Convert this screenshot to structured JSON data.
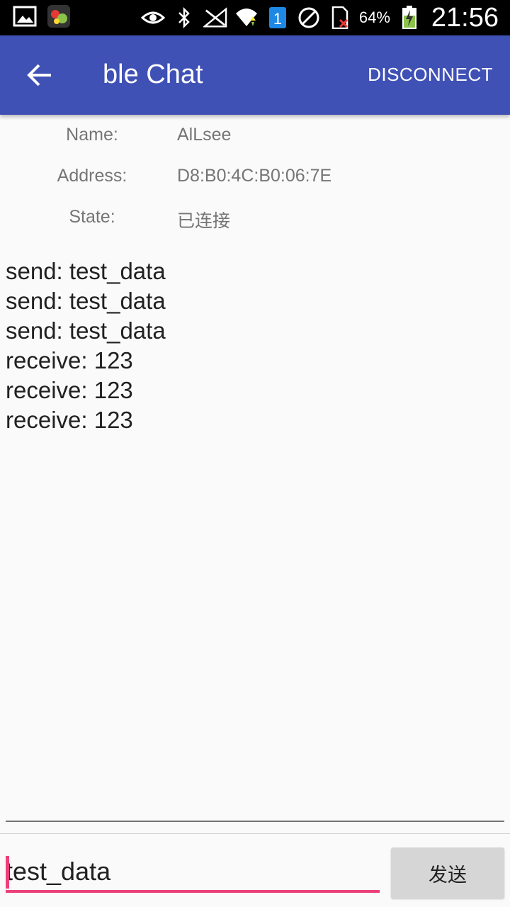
{
  "status_bar": {
    "battery_percent": "64%",
    "time": "21:56",
    "sim_badge": "1",
    "icons": [
      "gallery-icon",
      "app-notification-icon",
      "eye-icon",
      "bluetooth-icon",
      "no-signal-icon",
      "wifi-icon",
      "sim-icon",
      "block-icon",
      "sim-missing-icon",
      "battery-charging-icon"
    ]
  },
  "app_bar": {
    "title": "ble Chat",
    "action": "DISCONNECT",
    "color": "#3f51b5"
  },
  "device": {
    "name_label": "Name:",
    "name_value": "AlLsee",
    "address_label": "Address:",
    "address_value": "D8:B0:4C:B0:06:7E",
    "state_label": "State:",
    "state_value": "已连接"
  },
  "log": [
    "send: test_data",
    "send: test_data",
    "send: test_data",
    "receive: 123",
    "receive: 123",
    "receive: 123"
  ],
  "composer": {
    "input_value": "test_data",
    "send_label": "发送",
    "accent": "#ec407a"
  }
}
